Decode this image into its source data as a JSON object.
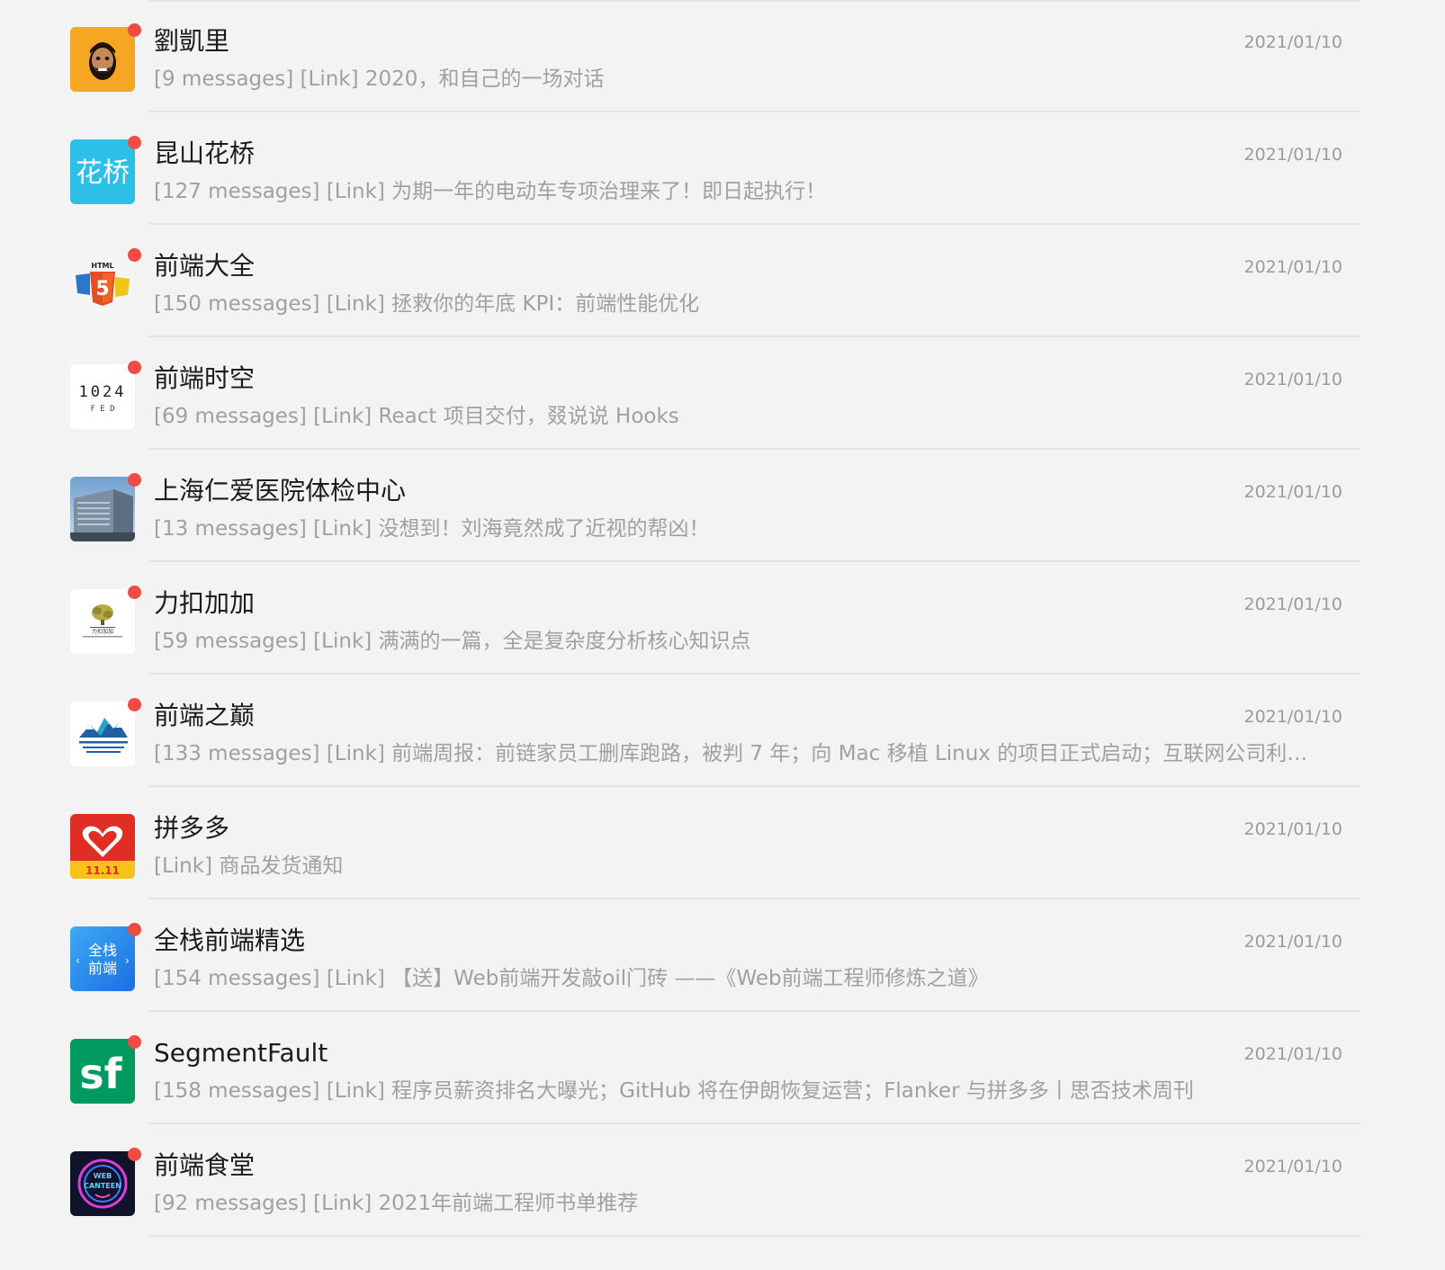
{
  "conversations": [
    {
      "name": "劉凱里",
      "preview": "[9 messages] [Link] 2020，和自己的一场对话",
      "date": "2021/01/10",
      "avatar_icon": "bearded-man-cartoon-icon",
      "unread": true
    },
    {
      "name": "昆山花桥",
      "preview": "[127 messages] [Link] 为期一年的电动车专项治理来了！即日起执行！",
      "date": "2021/01/10",
      "avatar_icon": "huaqiao-text-logo",
      "avatar_text": "花桥",
      "unread": true
    },
    {
      "name": "前端大全",
      "preview": "[150 messages] [Link] 拯救你的年底 KPI：前端性能优化",
      "date": "2021/01/10",
      "avatar_icon": "html5-css3-js-logo",
      "avatar_text": "HTML",
      "unread": true
    },
    {
      "name": "前端时空",
      "preview": "[69 messages] [Link] React 项目交付，叕说说 Hooks",
      "date": "2021/01/10",
      "avatar_icon": "1024-fed-logo",
      "avatar_text": "1024",
      "avatar_subtext": "F E D",
      "unread": true
    },
    {
      "name": "上海仁爱医院体检中心",
      "preview": "[13 messages] [Link] 没想到！刘海竟然成了近视的帮凶！",
      "date": "2021/01/10",
      "avatar_icon": "hospital-building-photo",
      "unread": true
    },
    {
      "name": "力扣加加",
      "preview": "[59 messages] [Link] 满满的一篇，全是复杂度分析核心知识点",
      "date": "2021/01/10",
      "avatar_icon": "brain-tree-logo",
      "avatar_text": "力扣加加",
      "unread": true
    },
    {
      "name": "前端之巅",
      "preview": "[133 messages] [Link] 前端周报：前链家员工删库跑路，被判 7 年；向 Mac 移植 Linux 的项目正式启动；互联网公司利…",
      "date": "2021/01/10",
      "avatar_icon": "mountain-peaks-logo",
      "unread": true
    },
    {
      "name": "拼多多",
      "preview": "[Link] 商品发货通知",
      "date": "2021/01/10",
      "avatar_icon": "pinduoduo-logo",
      "avatar_text": "11.11",
      "unread": false
    },
    {
      "name": "全栈前端精选",
      "preview": "[154 messages] [Link] 【送】Web前端开发敲oil门砖 ——《Web前端工程师修炼之道》",
      "date": "2021/01/10",
      "avatar_icon": "quanzhan-qianduan-logo",
      "avatar_text": "全栈",
      "avatar_subtext": "前端",
      "unread": true
    },
    {
      "name": "SegmentFault",
      "preview": "[158 messages] [Link] 程序员薪资排名大曝光；GitHub 将在伊朗恢复运营；Flanker 与拼多多丨思否技术周刊",
      "date": "2021/01/10",
      "avatar_icon": "sf-logo",
      "avatar_text": "sf",
      "unread": true
    },
    {
      "name": "前端食堂",
      "preview": "[92 messages] [Link] 2021年前端工程师书单推荐",
      "date": "2021/01/10",
      "avatar_icon": "web-canteen-neon-logo",
      "avatar_text": "WEB",
      "avatar_subtext": "CANTEEN",
      "unread": true
    }
  ],
  "colors": {
    "background": "#f3f3f3",
    "unread_dot": "#f04c44",
    "name_text": "#1b1b1b",
    "preview_text": "#a0a0a0",
    "date_text": "#9b9b9b",
    "separator": "#e3e3e3"
  }
}
